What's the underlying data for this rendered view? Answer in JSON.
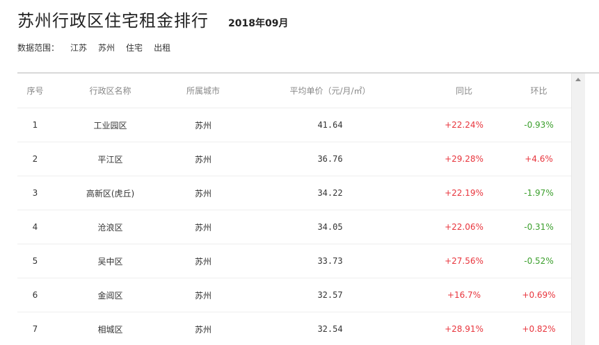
{
  "header": {
    "title": "苏州行政区住宅租金排行",
    "period": "2018年09月"
  },
  "filters": {
    "label": "数据范围：",
    "province": "江苏",
    "city": "苏州",
    "category": "住宅",
    "type": "出租"
  },
  "table": {
    "columns": [
      "序号",
      "行政区名称",
      "所属城市",
      "平均单价（元/月/㎡）",
      "同比",
      "环比"
    ],
    "rows": [
      {
        "rank": "1",
        "district": "工业园区",
        "city": "苏州",
        "price": "41.64",
        "yoy": "+22.24%",
        "mom": "-0.93%"
      },
      {
        "rank": "2",
        "district": "平江区",
        "city": "苏州",
        "price": "36.76",
        "yoy": "+29.28%",
        "mom": "+4.6%"
      },
      {
        "rank": "3",
        "district": "高新区(虎丘)",
        "city": "苏州",
        "price": "34.22",
        "yoy": "+22.19%",
        "mom": "-1.97%"
      },
      {
        "rank": "4",
        "district": "沧浪区",
        "city": "苏州",
        "price": "34.05",
        "yoy": "+22.06%",
        "mom": "-0.31%"
      },
      {
        "rank": "5",
        "district": "吴中区",
        "city": "苏州",
        "price": "33.73",
        "yoy": "+27.56%",
        "mom": "-0.52%"
      },
      {
        "rank": "6",
        "district": "金阊区",
        "city": "苏州",
        "price": "32.57",
        "yoy": "+16.7%",
        "mom": "+0.69%"
      },
      {
        "rank": "7",
        "district": "相城区",
        "city": "苏州",
        "price": "32.54",
        "yoy": "+28.91%",
        "mom": "+0.82%"
      }
    ]
  },
  "colors": {
    "increase": "#e8343c",
    "decrease": "#3a9e2b"
  }
}
